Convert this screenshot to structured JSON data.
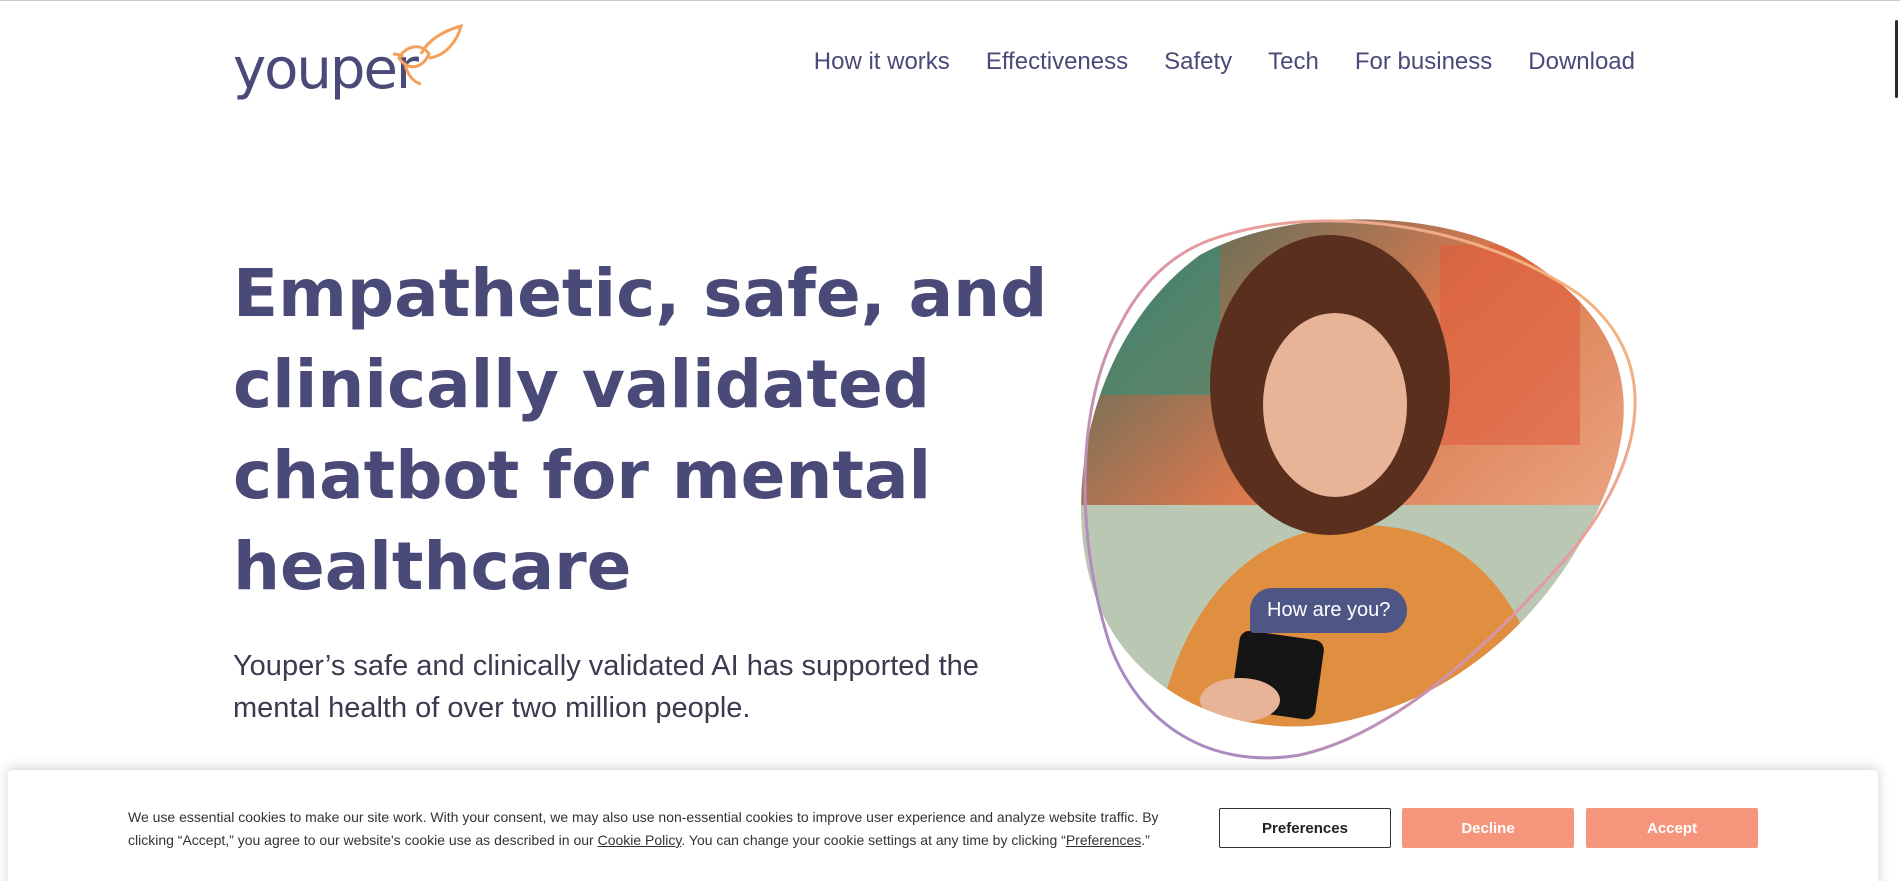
{
  "header": {
    "logo_text": "youper",
    "nav": [
      {
        "label": "How it works"
      },
      {
        "label": "Effectiveness"
      },
      {
        "label": "Safety"
      },
      {
        "label": "Tech"
      },
      {
        "label": "For business"
      },
      {
        "label": "Download"
      }
    ]
  },
  "hero": {
    "title": "Empathetic, safe, and clinically validated chatbot for mental healthcare",
    "subtitle": "Youper’s safe and clinically validated AI has supported the mental health of over two million people.",
    "chat_bubble": "How are you?",
    "image_icon": "woman-with-phone-photo"
  },
  "cookie_banner": {
    "text_part1": "We use essential cookies to make our site work. With your consent, we may also use non-essential cookies to improve user experience and analyze website traffic. By clicking “Accept,” you agree to our website's cookie use as described in our ",
    "cookie_policy_link": "Cookie Policy",
    "text_part2": ". You can change your cookie settings at any time by clicking “",
    "preferences_link": "Preferences",
    "text_part3": ".”",
    "preferences_button": "Preferences",
    "decline_button": "Decline",
    "accept_button": "Accept"
  },
  "colors": {
    "brand_navy": "#4a4a78",
    "brand_orange": "#f5a05a",
    "button_coral": "#f5967c",
    "bubble": "#4d5685"
  }
}
